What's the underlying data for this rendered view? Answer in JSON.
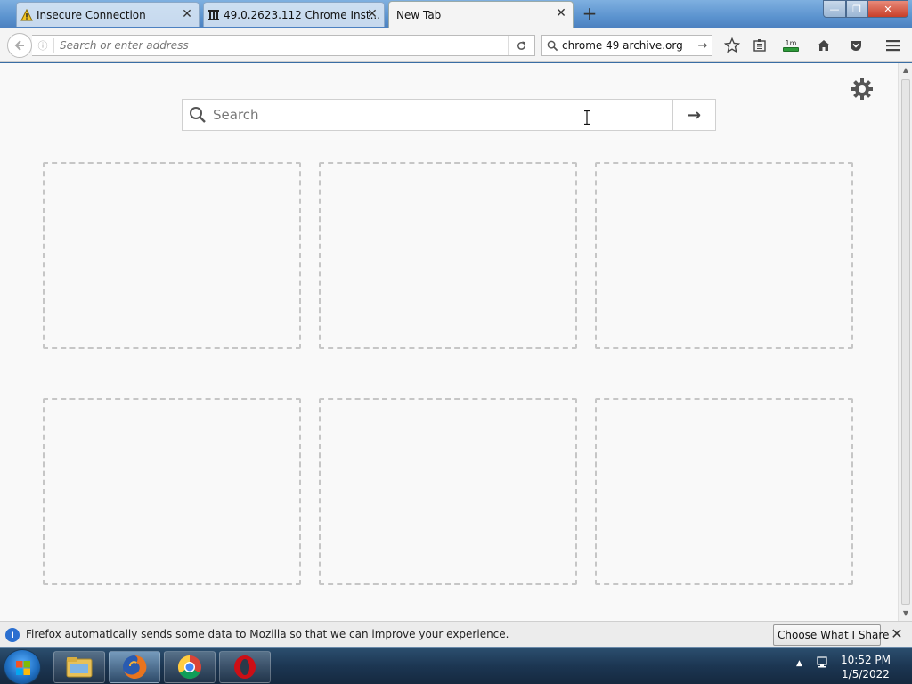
{
  "browser": {
    "tabs": [
      {
        "label": "Insecure Connection",
        "icon": "warning-icon"
      },
      {
        "label": "49.0.2623.112 Chrome Inst...",
        "icon": "archive-icon"
      },
      {
        "label": "New Tab",
        "icon": "none",
        "active": true
      }
    ],
    "newtab_symbol": "+",
    "window_controls": {
      "minimize": "—",
      "maximize": "❐",
      "close": "✕"
    }
  },
  "navbar": {
    "url_placeholder": "Search or enter address",
    "search_value": "chrome 49 archive.org",
    "download_badge": "1m"
  },
  "newtab": {
    "search_placeholder": "Search",
    "tiles_count": 6
  },
  "notification": {
    "message": "Firefox automatically sends some data to Mozilla so that we can improve your experience.",
    "button_label": "Choose What I Share"
  },
  "taskbar": {
    "apps": [
      "file-explorer-icon",
      "firefox-icon",
      "chrome-icon",
      "opera-icon"
    ],
    "clock_time": "10:52 PM",
    "clock_date": "1/5/2022"
  },
  "colors": {
    "accent": "#2a6fd0",
    "tile_border": "#c6c6c6",
    "content_bg": "#f9f9f9"
  }
}
